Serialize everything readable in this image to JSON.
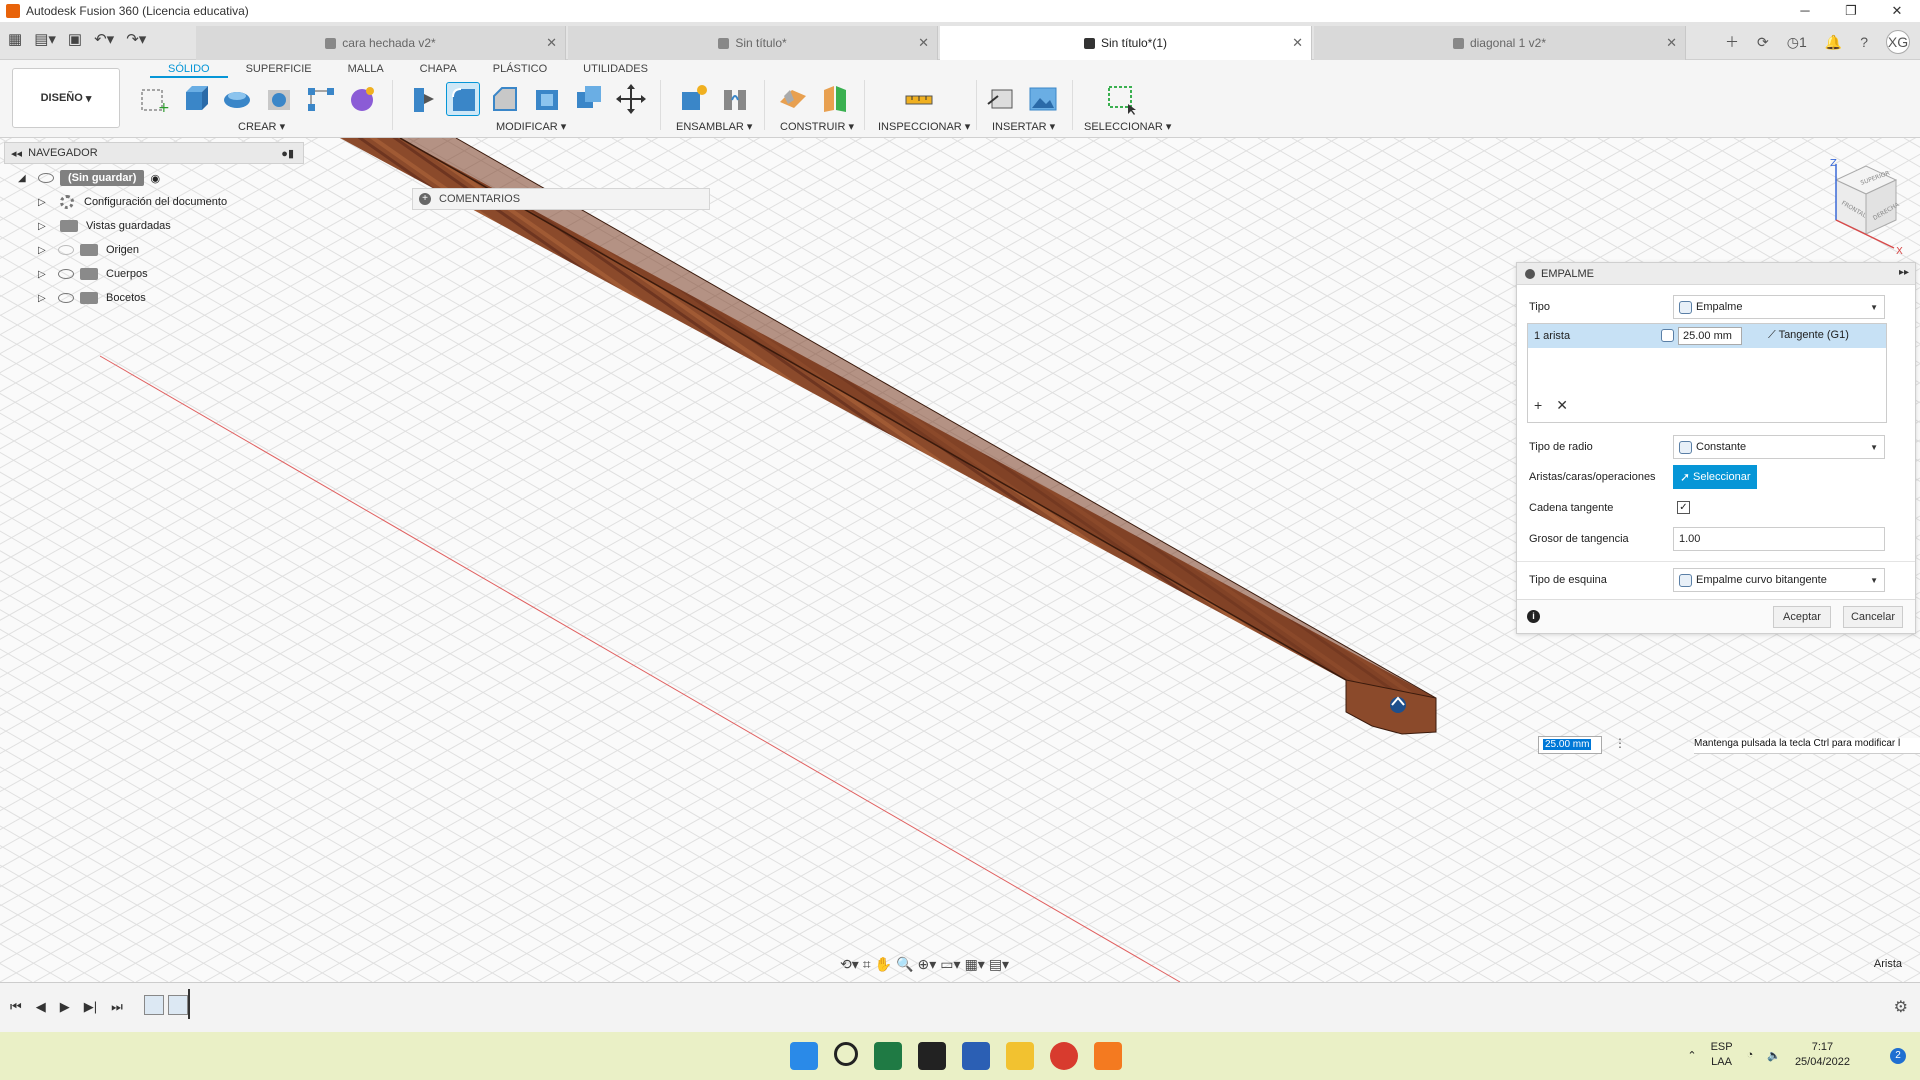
{
  "window": {
    "title": "Autodesk Fusion 360 (Licencia educativa)"
  },
  "doc_tabs": [
    {
      "label": "cara hechada v2*"
    },
    {
      "label": "Sin título*"
    },
    {
      "label": "Sin título*(1)"
    },
    {
      "label": "diagonal 1 v2*"
    }
  ],
  "header_icons": {
    "jobs_count": "1",
    "user_initials": "XG"
  },
  "ribbon": {
    "design_label": "DISEÑO",
    "tabs": [
      "SÓLIDO",
      "SUPERFICIE",
      "MALLA",
      "CHAPA",
      "PLÁSTICO",
      "UTILIDADES"
    ],
    "groups": [
      "CREAR",
      "MODIFICAR",
      "ENSAMBLAR",
      "CONSTRUIR",
      "INSPECCIONAR",
      "INSERTAR",
      "SELECCIONAR"
    ]
  },
  "navigator": {
    "title": "NAVEGADOR",
    "root": "(Sin guardar)",
    "items": [
      "Configuración del documento",
      "Vistas guardadas",
      "Origen",
      "Cuerpos",
      "Bocetos"
    ]
  },
  "comments": {
    "label": "COMENTARIOS"
  },
  "viewcube": {
    "top": "SUPERIOR",
    "front": "FRONTAL",
    "right": "DERECHA",
    "axis_z": "Z",
    "axis_x": "X"
  },
  "fillet_panel": {
    "title": "EMPALME",
    "tipo_label": "Tipo",
    "tipo_value": "Empalme",
    "edge_count": "1 arista",
    "radius": "25.00 mm",
    "continuity": "Tangente (G1)",
    "tipo_radio_label": "Tipo de radio",
    "tipo_radio_value": "Constante",
    "aristas_label": "Aristas/caras/operaciones",
    "select_button": "Seleccionar",
    "cadena_label": "Cadena tangente",
    "cadena_checked": true,
    "grosor_label": "Grosor de tangencia",
    "grosor_value": "1.00",
    "esquina_label": "Tipo de esquina",
    "esquina_value": "Empalme curvo bitangente",
    "ok": "Aceptar",
    "cancel": "Cancelar"
  },
  "dim_input": "25.00 mm",
  "tooltip": "Mantenga pulsada la tecla Ctrl para modificar l",
  "selection_mode": "Arista",
  "taskbar": {
    "lang1": "ESP",
    "lang2": "LAA",
    "time": "7:17",
    "date": "25/04/2022",
    "notifications": "2"
  },
  "colors": {
    "accent": "#0696d7",
    "wood": "#8b4a2b",
    "taskbar": "#eaf0c6"
  }
}
